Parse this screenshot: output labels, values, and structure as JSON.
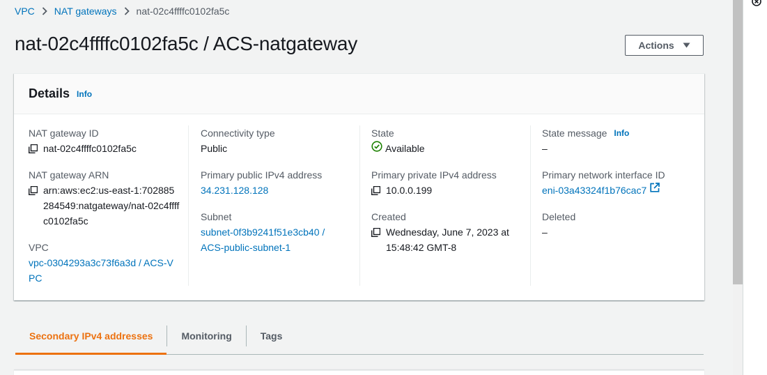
{
  "breadcrumb": {
    "items": [
      "VPC",
      "NAT gateways"
    ],
    "current": "nat-02c4ffffc0102fa5c"
  },
  "page": {
    "title": "nat-02c4ffffc0102fa5c / ACS-natgateway",
    "actions_label": "Actions"
  },
  "details": {
    "title": "Details",
    "info_label": "Info",
    "nat_gateway_id": {
      "label": "NAT gateway ID",
      "value": "nat-02c4ffffc0102fa5c"
    },
    "nat_gateway_arn": {
      "label": "NAT gateway ARN",
      "value": "arn:aws:ec2:us-east-1:702885284549:natgateway/nat-02c4ffffc0102fa5c"
    },
    "vpc": {
      "label": "VPC",
      "value": "vpc-0304293a3c73f6a3d / ACS-VPC"
    },
    "connectivity_type": {
      "label": "Connectivity type",
      "value": "Public"
    },
    "primary_public_ipv4": {
      "label": "Primary public IPv4 address",
      "value": "34.231.128.128"
    },
    "subnet": {
      "label": "Subnet",
      "value": "subnet-0f3b9241f51e3cb40 / ACS-public-subnet-1"
    },
    "state": {
      "label": "State",
      "value": "Available"
    },
    "primary_private_ipv4": {
      "label": "Primary private IPv4 address",
      "value": "10.0.0.199"
    },
    "created": {
      "label": "Created",
      "value": "Wednesday, June 7, 2023 at 15:48:42 GMT-8"
    },
    "state_message": {
      "label": "State message",
      "info_label": "Info",
      "value": "–"
    },
    "primary_eni": {
      "label": "Primary network interface ID",
      "value": "eni-03a43324f1b76cac7"
    },
    "deleted": {
      "label": "Deleted",
      "value": "–"
    }
  },
  "tabs": [
    {
      "label": "Secondary IPv4 addresses",
      "active": true
    },
    {
      "label": "Monitoring",
      "active": false
    },
    {
      "label": "Tags",
      "active": false
    }
  ],
  "colors": {
    "link": "#0073bb",
    "active_tab": "#ec7211",
    "success": "#1d8102",
    "background": "#f2f3f3"
  },
  "icons": [
    "chevron-right-icon",
    "caret-down-icon",
    "copy-icon",
    "status-check-icon",
    "external-link-icon",
    "close-icon"
  ]
}
